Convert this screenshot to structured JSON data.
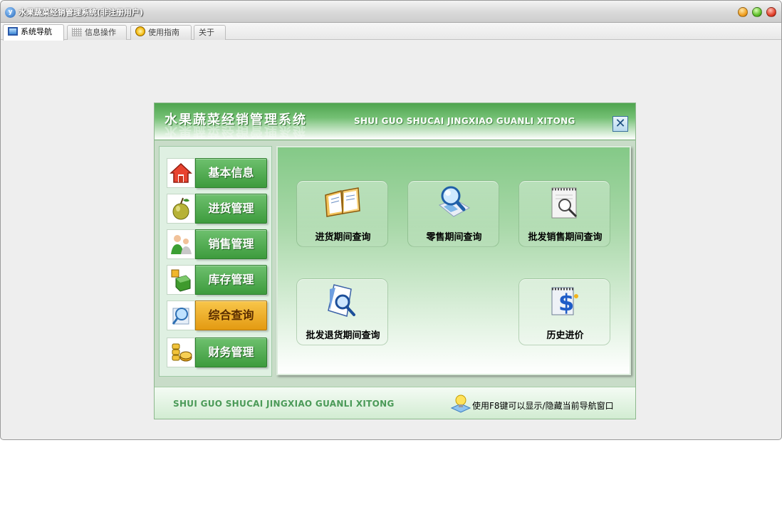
{
  "window": {
    "title": "水果蔬菜经销管理系统(非注册用户)",
    "icon_letter": "y"
  },
  "tabs": [
    {
      "label": "系统导航",
      "icon": "monitor-icon",
      "active": true
    },
    {
      "label": "信息操作",
      "icon": "grid-icon",
      "active": false
    },
    {
      "label": "使用指南",
      "icon": "help-icon",
      "active": false
    },
    {
      "label": "关于",
      "icon": "",
      "active": false
    }
  ],
  "dialog": {
    "title_cn": "水果蔬菜经销管理系统",
    "title_en": "SHUI GUO SHUCAI JINGXIAO GUANLI XITONG",
    "close_glyph": "✕"
  },
  "menu": {
    "items": [
      {
        "label": "基本信息",
        "icon": "house-icon",
        "active": false
      },
      {
        "label": "进货管理",
        "icon": "apple-icon",
        "active": false
      },
      {
        "label": "销售管理",
        "icon": "people-icon",
        "active": false
      },
      {
        "label": "库存管理",
        "icon": "boxes-icon",
        "active": false
      },
      {
        "label": "综合查询",
        "icon": "magnifier-icon",
        "active": true
      },
      {
        "label": "财务管理",
        "icon": "coins-icon",
        "active": false
      }
    ]
  },
  "features": [
    {
      "label": "进货期间查询",
      "icon": "open-book-icon"
    },
    {
      "label": "零售期间查询",
      "icon": "search-map-icon"
    },
    {
      "label": "批发销售期间查询",
      "icon": "notepad-search-icon"
    },
    {
      "label": "批发退货期间查询",
      "icon": "document-search-icon"
    },
    {
      "label": "历史进价",
      "icon": "dollar-document-icon"
    }
  ],
  "footer": {
    "title_en": "SHUI GUO SHUCAI JINGXIAO GUANLI XITONG",
    "hint": "使用F8键可以显示/隐藏当前导航窗口",
    "hint_icon": "lightbulb-icon"
  }
}
